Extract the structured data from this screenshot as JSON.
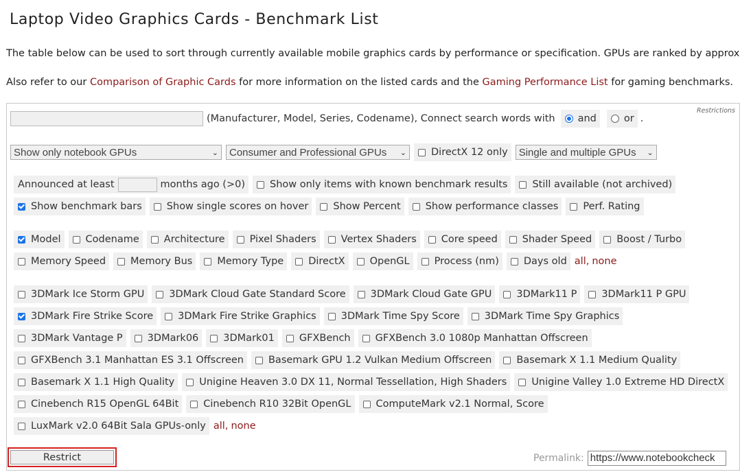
{
  "title": "Laptop Video Graphics Cards - Benchmark List",
  "intro": "The table below can be used to sort through currently available mobile graphics cards by performance or specification. GPUs are ranked by approximate",
  "refer": {
    "pre": "Also refer to our ",
    "link1": "Comparison of Graphic Cards",
    "mid": " for more information on the listed cards and the ",
    "link2": "Gaming Performance List",
    "post": " for gaming benchmarks."
  },
  "panel": {
    "restrictions_label": "Restrictions",
    "search": {
      "value": "",
      "hint": "(Manufacturer, Model, Series, Codename), Connect search words with",
      "and_label": "and",
      "or_label": "or",
      "selected": "and",
      "end": "."
    },
    "selects": {
      "gpu_type": "Show only notebook GPUs",
      "segment": "Consumer and Professional GPUs",
      "multi": "Single and multiple GPUs"
    },
    "directx12": {
      "label": "DirectX 12 only",
      "checked": false
    },
    "announced": {
      "pre": "Announced at least",
      "value": "",
      "post": "months ago (>0)"
    },
    "known_results": {
      "label": "Show only items with known benchmark results",
      "checked": false
    },
    "still_available": {
      "label": "Still available (not archived)",
      "checked": false
    },
    "display_opts": [
      {
        "label": "Show benchmark bars",
        "checked": true
      },
      {
        "label": "Show single scores on hover",
        "checked": false
      },
      {
        "label": "Show Percent",
        "checked": false
      },
      {
        "label": "Show performance classes",
        "checked": false
      },
      {
        "label": "Perf. Rating",
        "checked": false
      }
    ],
    "columns_row1": [
      {
        "label": "Model",
        "checked": true
      },
      {
        "label": "Codename",
        "checked": false
      },
      {
        "label": "Architecture",
        "checked": false
      },
      {
        "label": "Pixel Shaders",
        "checked": false
      },
      {
        "label": "Vertex Shaders",
        "checked": false
      },
      {
        "label": "Core speed",
        "checked": false
      },
      {
        "label": "Shader Speed",
        "checked": false
      },
      {
        "label": "Boost / Turbo",
        "checked": false
      }
    ],
    "columns_row2": [
      {
        "label": "Memory Speed",
        "checked": false
      },
      {
        "label": "Memory Bus",
        "checked": false
      },
      {
        "label": "Memory Type",
        "checked": false
      },
      {
        "label": "DirectX",
        "checked": false
      },
      {
        "label": "OpenGL",
        "checked": false
      },
      {
        "label": "Process (nm)",
        "checked": false
      },
      {
        "label": "Days old",
        "checked": false
      }
    ],
    "all_label": "all",
    "none_label": "none",
    "bench_rows": [
      [
        {
          "label": "3DMark Ice Storm GPU",
          "checked": false
        },
        {
          "label": "3DMark Cloud Gate Standard Score",
          "checked": false
        },
        {
          "label": "3DMark Cloud Gate GPU",
          "checked": false
        },
        {
          "label": "3DMark11 P",
          "checked": false
        },
        {
          "label": "3DMark11 P GPU",
          "checked": false
        }
      ],
      [
        {
          "label": "3DMark Fire Strike Score",
          "checked": true
        },
        {
          "label": "3DMark Fire Strike Graphics",
          "checked": false
        },
        {
          "label": "3DMark Time Spy Score",
          "checked": false
        },
        {
          "label": "3DMark Time Spy Graphics",
          "checked": false
        }
      ],
      [
        {
          "label": "3DMark Vantage P",
          "checked": false
        },
        {
          "label": "3DMark06",
          "checked": false
        },
        {
          "label": "3DMark01",
          "checked": false
        },
        {
          "label": "GFXBench",
          "checked": false
        },
        {
          "label": "GFXBench 3.0 1080p Manhattan Offscreen",
          "checked": false
        }
      ],
      [
        {
          "label": "GFXBench 3.1 Manhattan ES 3.1 Offscreen",
          "checked": false
        },
        {
          "label": "Basemark GPU 1.2 Vulkan Medium Offscreen",
          "checked": false
        },
        {
          "label": "Basemark X 1.1 Medium Quality",
          "checked": false
        }
      ],
      [
        {
          "label": "Basemark X 1.1 High Quality",
          "checked": false
        },
        {
          "label": "Unigine Heaven 3.0 DX 11, Normal Tessellation, High Shaders",
          "checked": false
        },
        {
          "label": "Unigine Valley 1.0 Extreme HD DirectX",
          "checked": false
        }
      ],
      [
        {
          "label": "Cinebench R15 OpenGL 64Bit",
          "checked": false
        },
        {
          "label": "Cinebench R10 32Bit OpenGL",
          "checked": false
        },
        {
          "label": "ComputeMark v2.1 Normal, Score",
          "checked": false
        }
      ],
      [
        {
          "label": "LuxMark v2.0 64Bit Sala GPUs-only",
          "checked": false
        }
      ]
    ],
    "restrict_label": "Restrict",
    "permalink_label": "Permalink:",
    "permalink_value": "https://www.notebookcheck"
  }
}
